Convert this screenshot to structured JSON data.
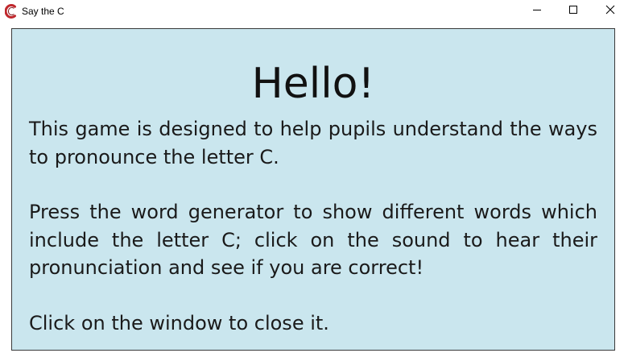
{
  "window": {
    "title": "Say the C",
    "icons": {
      "app": "app-c-icon",
      "minimize": "minimize-icon",
      "maximize": "maximize-icon",
      "close": "close-icon"
    }
  },
  "panel": {
    "background": "#cae6ee",
    "heading": "Hello!",
    "paragraph1": "This game is designed to help pupils understand the ways to pronounce the letter C.",
    "paragraph2": "Press the word generator to show different words which include the letter C; click on the sound to hear their pronunciation and see if you are correct!",
    "paragraph3": "Click on the window to close it."
  }
}
